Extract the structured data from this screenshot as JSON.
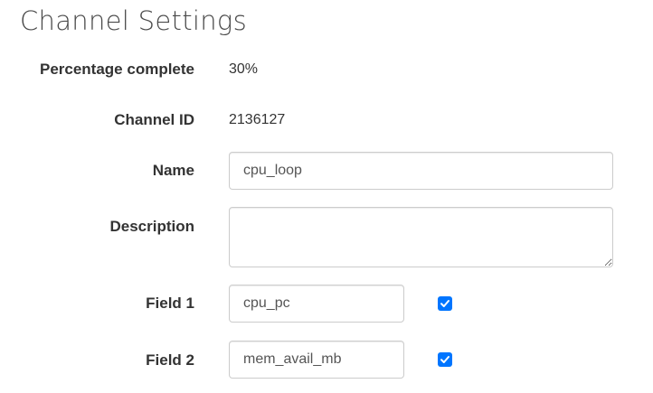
{
  "page": {
    "title": "Channel Settings"
  },
  "form": {
    "percentage_complete": {
      "label": "Percentage complete",
      "value": "30%"
    },
    "channel_id": {
      "label": "Channel ID",
      "value": "2136127"
    },
    "name": {
      "label": "Name",
      "value": "cpu_loop"
    },
    "description": {
      "label": "Description",
      "value": ""
    },
    "fields": [
      {
        "label": "Field 1",
        "value": "cpu_pc",
        "enabled": true
      },
      {
        "label": "Field 2",
        "value": "mem_avail_mb",
        "enabled": true
      }
    ]
  },
  "colors": {
    "checkbox_accent": "#0075ff",
    "input_border": "#cccccc",
    "text": "#333333"
  },
  "icons": {
    "checkbox_checked": "checkmark-icon"
  }
}
